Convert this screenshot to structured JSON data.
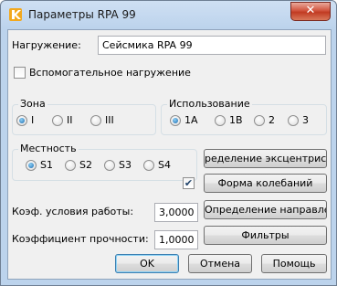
{
  "window": {
    "title": "Параметры RPA 99",
    "close_glyph": "✕"
  },
  "load": {
    "label": "Нагружение:",
    "value": "Сейсмика RPA 99"
  },
  "auxiliary": {
    "label": "Вспомогательное нагружение",
    "checked": false
  },
  "zone": {
    "label": "Зона",
    "options": [
      "I",
      "II",
      "III"
    ],
    "selected": "I"
  },
  "usage": {
    "label": "Использование",
    "options": [
      "1A",
      "1B",
      "2",
      "3"
    ],
    "selected": "1A"
  },
  "terrain": {
    "label": "Местность",
    "options": [
      "S1",
      "S2",
      "S3",
      "S4"
    ],
    "selected": "S1"
  },
  "buttons": {
    "eccentricity": "ределение эксцентрисите",
    "modes": "Форма колебаний",
    "direction": "Определение направления",
    "filters": "Фильтры",
    "ok": "OK",
    "cancel": "Отмена",
    "help": "Помощь"
  },
  "modes_check": {
    "checked": true,
    "glyph": "✔"
  },
  "work_coef": {
    "label": "Коэф. условия работы:",
    "value": "3,0000"
  },
  "strength_coef": {
    "label": "Коэффициент прочности:",
    "value": "1,0000"
  }
}
